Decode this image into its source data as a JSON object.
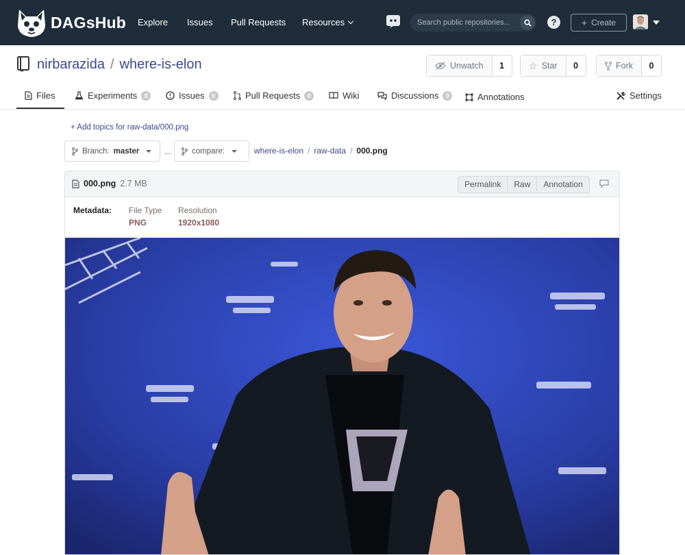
{
  "nav": {
    "logo_text": "DAGsHub",
    "links": [
      "Explore",
      "Issues",
      "Pull Requests",
      "Resources"
    ],
    "search_placeholder": "Search public repositories...",
    "help_label": "?",
    "create_label": "Create"
  },
  "repo": {
    "owner": "nirbarazida",
    "separator": "/",
    "name": "where-is-elon",
    "unwatch_label": "Unwatch",
    "unwatch_count": "1",
    "star_label": "Star",
    "star_count": "0",
    "fork_label": "Fork",
    "fork_count": "0"
  },
  "tabs": [
    {
      "label": "Files"
    },
    {
      "label": "Experiments",
      "badge": "0"
    },
    {
      "label": "Issues",
      "badge": "0"
    },
    {
      "label": "Pull Requests",
      "badge": "0"
    },
    {
      "label": "Wiki"
    },
    {
      "label": "Discussions",
      "badge": "0"
    },
    {
      "label": "Annotations"
    },
    {
      "label": "Settings"
    }
  ],
  "topics": {
    "add_label": "+ Add topics for raw-data/000.png"
  },
  "branch": {
    "prefix": "Branch:",
    "value": "master",
    "compare_label": "compare:",
    "ellipsis": "..."
  },
  "breadcrumb": {
    "root": "where-is-elon",
    "folder": "raw-data",
    "file": "000.png",
    "sep": "/"
  },
  "file": {
    "name": "000.png",
    "size": "2.7 MB",
    "actions": [
      "Permalink",
      "Raw",
      "Annotation"
    ],
    "metadata_label": "Metadata:",
    "metadata": [
      {
        "key": "File Type",
        "value": "PNG"
      },
      {
        "key": "Resolution",
        "value": "1920x1080"
      }
    ]
  },
  "colors": {
    "nav_bg": "#1f2d3a",
    "link": "#3a4a8c",
    "metadata_value": "#8b5a5a",
    "photo_bg": "#2a3ea8"
  }
}
